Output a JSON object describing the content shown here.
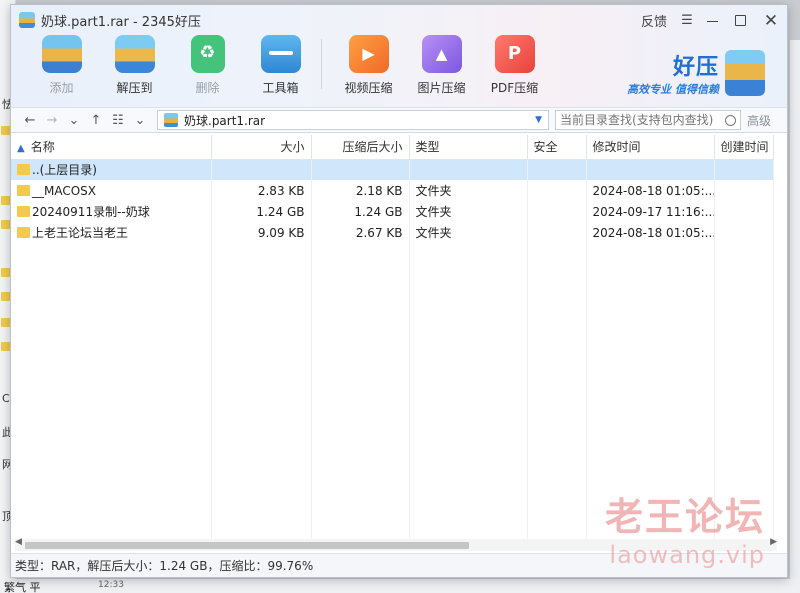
{
  "window": {
    "title": "奶球.part1.rar - 2345好压"
  },
  "controls": {
    "feedback": "反馈"
  },
  "toolbar": {
    "buttons": [
      {
        "label": "添加",
        "icon": "add-archive-icon",
        "enabled": false
      },
      {
        "label": "解压到",
        "icon": "extract-icon",
        "enabled": true
      },
      {
        "label": "删除",
        "icon": "recycle-delete-icon",
        "enabled": false
      },
      {
        "label": "工具箱",
        "icon": "toolbox-icon",
        "enabled": true
      },
      {
        "label": "视频压缩",
        "icon": "video-compress-icon",
        "enabled": true
      },
      {
        "label": "图片压缩",
        "icon": "image-compress-icon",
        "enabled": true
      },
      {
        "label": "PDF压缩",
        "icon": "pdf-compress-icon",
        "enabled": true
      }
    ]
  },
  "brand": {
    "name": "好压",
    "slogan": "高效专业 值得信赖"
  },
  "nav": {
    "path": "奶球.part1.rar",
    "search_placeholder": "当前目录查找(支持包内查找)",
    "advanced": "高级"
  },
  "table": {
    "columns": [
      "名称",
      "大小",
      "压缩后大小",
      "类型",
      "安全",
      "修改时间",
      "创建时间"
    ],
    "rows": [
      {
        "name": "..(上层目录)",
        "size": "",
        "packed": "",
        "type": "",
        "safe": "",
        "modified": "",
        "created": "",
        "selected": true
      },
      {
        "name": "__MACOSX",
        "size": "2.83 KB",
        "packed": "2.18 KB",
        "type": "文件夹",
        "safe": "",
        "modified": "2024-08-18 01:05:...",
        "created": ""
      },
      {
        "name": "20240911录制--奶球",
        "size": "1.24 GB",
        "packed": "1.24 GB",
        "type": "文件夹",
        "safe": "",
        "modified": "2024-09-17 11:16:...",
        "created": ""
      },
      {
        "name": "上老王论坛当老王",
        "size": "9.09 KB",
        "packed": "2.67 KB",
        "type": "文件夹",
        "safe": "",
        "modified": "2024-08-18 01:05:...",
        "created": ""
      }
    ]
  },
  "status": {
    "text": "类型：RAR，解压后大小：1.24 GB，压缩比：99.76%"
  },
  "watermark": {
    "title": "老王论坛",
    "url": "laowang.vip"
  },
  "desktop": {
    "left_glyphs": [
      "怯",
      "C",
      "此",
      "网",
      "顶"
    ],
    "bottom_text": "繁气 平",
    "bottom_time": "12:33"
  }
}
